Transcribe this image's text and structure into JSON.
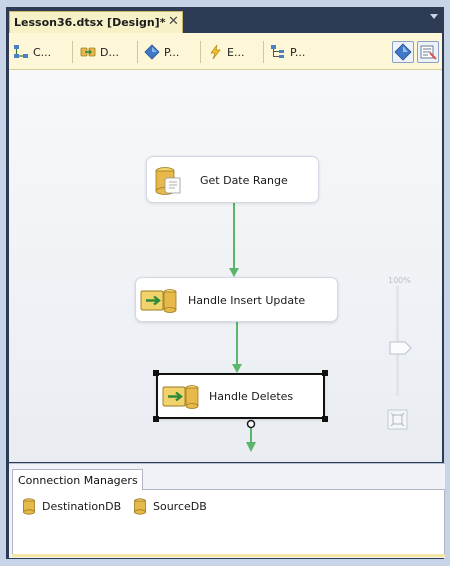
{
  "document_tab": {
    "title": "Lesson36.dtsx [Design]*",
    "close_glyph": "✕"
  },
  "toolbar": {
    "tabs": [
      {
        "label": "C...",
        "icon": "control-flow-icon"
      },
      {
        "label": "D...",
        "icon": "data-flow-icon"
      },
      {
        "label": "P...",
        "icon": "parameters-icon"
      },
      {
        "label": "E...",
        "icon": "event-handlers-icon"
      },
      {
        "label": "P...",
        "icon": "package-explorer-icon"
      }
    ],
    "right_buttons": [
      "variables-icon",
      "toolbox-icon"
    ]
  },
  "canvas": {
    "tasks": [
      {
        "label": "Get Date Range",
        "icon": "execute-sql-task-icon",
        "selected": false
      },
      {
        "label": "Handle Insert Update",
        "icon": "data-flow-task-icon",
        "selected": false
      },
      {
        "label": "Handle Deletes",
        "icon": "data-flow-task-icon",
        "selected": true
      }
    ],
    "zoom": {
      "label": "100%"
    },
    "connector_color": "#5bb56a"
  },
  "connection_managers": {
    "tab_label": "Connection Managers",
    "items": [
      {
        "label": "DestinationDB",
        "icon": "database-icon"
      },
      {
        "label": "SourceDB",
        "icon": "database-icon"
      }
    ]
  },
  "colors": {
    "tab_accent": "#f7f1c8",
    "window_frame": "#2d3b55",
    "selection_border": "#111111"
  }
}
